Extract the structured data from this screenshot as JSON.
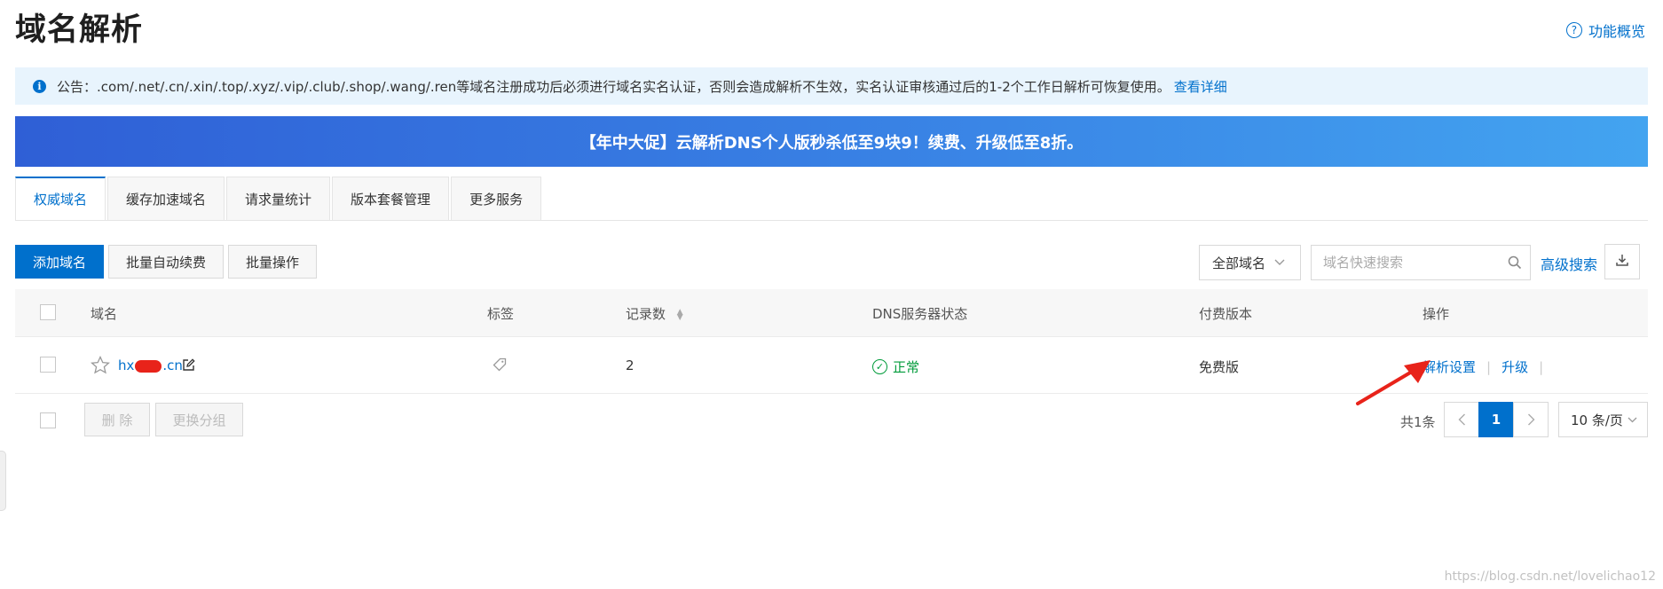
{
  "page": {
    "title": "域名解析",
    "help_label": "功能概览"
  },
  "notice": {
    "text": "公告：.com/.net/.cn/.xin/.top/.xyz/.vip/.club/.shop/.wang/.ren等域名注册成功后必须进行域名实名认证，否则会造成解析不生效，实名认证审核通过后的1-2个工作日解析可恢复使用。",
    "link_label": "查看详细"
  },
  "banner": {
    "text": "【年中大促】云解析DNS个人版秒杀低至9块9！续费、升级低至8折。"
  },
  "tabs": [
    {
      "label": "权威域名",
      "active": true
    },
    {
      "label": "缓存加速域名",
      "active": false
    },
    {
      "label": "请求量统计",
      "active": false
    },
    {
      "label": "版本套餐管理",
      "active": false
    },
    {
      "label": "更多服务",
      "active": false
    }
  ],
  "toolbar": {
    "add_label": "添加域名",
    "auto_renew_label": "批量自动续费",
    "batch_label": "批量操作",
    "filter_value": "全部域名",
    "search_placeholder": "域名快速搜索",
    "advanced_search_label": "高级搜索"
  },
  "table": {
    "columns": {
      "domain": "域名",
      "tag": "标签",
      "records": "记录数",
      "dns_status": "DNS服务器状态",
      "edition": "付费版本",
      "actions": "操作"
    },
    "rows": [
      {
        "domain": "hx",
        "domain_suffix": ".cn",
        "records": "2",
        "dns_status": "正常",
        "edition": "免费版",
        "action_resolve": "解析设置",
        "action_upgrade": "升级"
      }
    ]
  },
  "footer": {
    "delete_label": "删 除",
    "change_group_label": "更换分组",
    "total_label": "共1条",
    "current_page": "1",
    "page_size": "10 条/页"
  },
  "watermark": "https://blog.csdn.net/lovelichao12",
  "colors": {
    "accent": "#0070cc",
    "success": "#009b3a",
    "annotation": "#e8231a"
  }
}
